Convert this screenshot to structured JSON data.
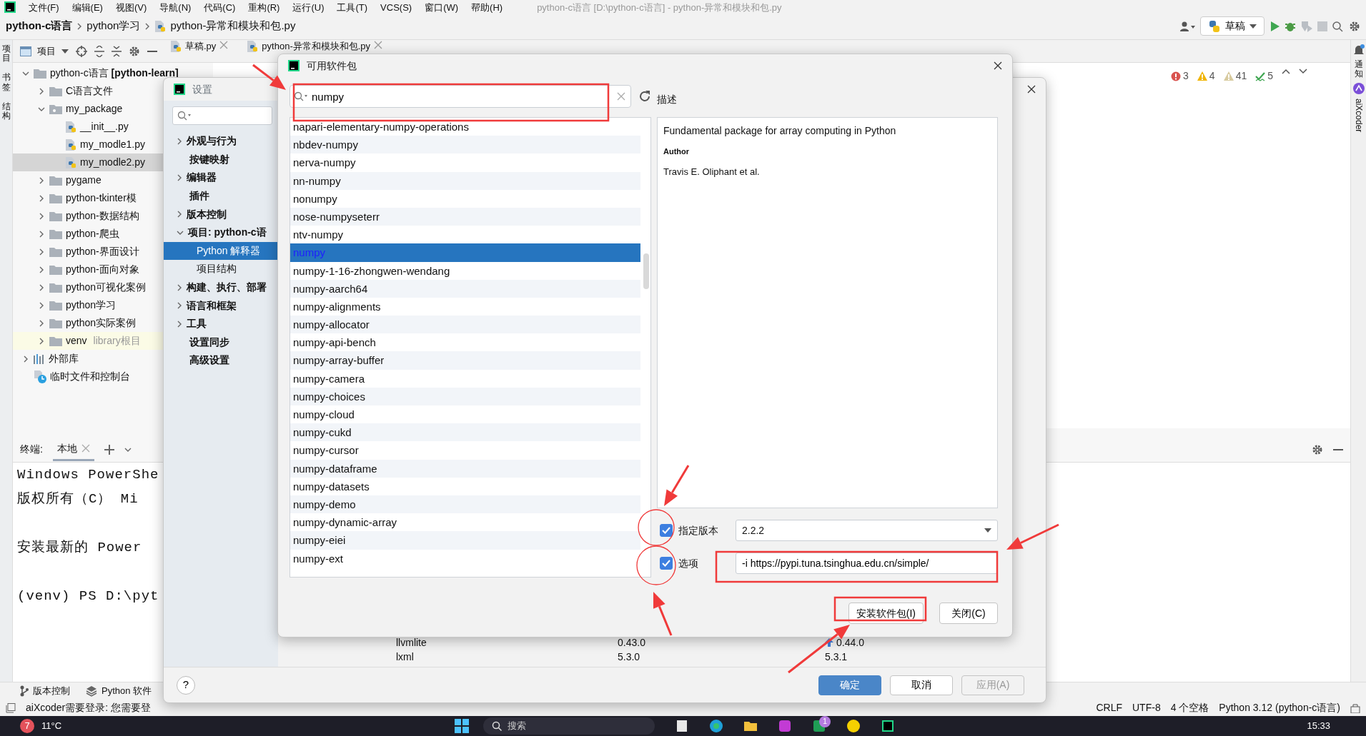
{
  "menu": [
    "文件(F)",
    "编辑(E)",
    "视图(V)",
    "导航(N)",
    "代码(C)",
    "重构(R)",
    "运行(U)",
    "工具(T)",
    "VCS(S)",
    "窗口(W)",
    "帮助(H)"
  ],
  "window": {
    "title": "python-c语言 [D:\\python-c语言] - python-异常和模块和包.py"
  },
  "breadcrumbs": [
    "python-c语言",
    "python学习",
    "python-异常和模块和包.py"
  ],
  "run_config": {
    "label": "草稿"
  },
  "left_stripe": [
    "项目",
    "书签",
    "结构"
  ],
  "project_view": {
    "label": "项目"
  },
  "editor_tabs": [
    {
      "label": "草稿.py"
    },
    {
      "label": "python-异常和模块和包.py"
    }
  ],
  "inspections": [
    {
      "kind": "error",
      "count": "3"
    },
    {
      "kind": "warning",
      "count": "4"
    },
    {
      "kind": "weak",
      "count": "41"
    },
    {
      "kind": "ok",
      "count": "5"
    }
  ],
  "project_tree": [
    {
      "label": "python-c语言 **[python-learn]**",
      "kind": "folder",
      "expanded": true,
      "selected": false,
      "children": [
        {
          "label": "C语言文件",
          "kind": "folder",
          "expanded": false,
          "selected": false
        },
        {
          "label": "my_package",
          "kind": "package",
          "expanded": true,
          "selected": false,
          "children": [
            {
              "label": "__init__.py",
              "kind": "file",
              "selected": false
            },
            {
              "label": "my_modle1.py",
              "kind": "file",
              "selected": false
            },
            {
              "label": "my_modle2.py",
              "kind": "file",
              "selected": true
            }
          ]
        },
        {
          "label": "pygame",
          "kind": "folder",
          "expanded": false,
          "selected": false
        },
        {
          "label": "python-tkinter模",
          "kind": "folder",
          "expanded": false,
          "selected": false
        },
        {
          "label": "python-数据结构",
          "kind": "folder",
          "expanded": false,
          "selected": false
        },
        {
          "label": "python-爬虫",
          "kind": "folder",
          "expanded": false,
          "selected": false
        },
        {
          "label": "python-界面设计",
          "kind": "folder",
          "expanded": false,
          "selected": false
        },
        {
          "label": "python-面向对象",
          "kind": "folder",
          "expanded": false,
          "selected": false
        },
        {
          "label": "python可视化案例",
          "kind": "folder",
          "expanded": false,
          "selected": false
        },
        {
          "label": "python学习",
          "kind": "folder",
          "expanded": false,
          "selected": false
        },
        {
          "label": "python实际案例",
          "kind": "folder",
          "expanded": false,
          "selected": false
        },
        {
          "label": "venv",
          "hint": "library根目",
          "kind": "venv",
          "expanded": false,
          "selected": false
        }
      ]
    },
    {
      "label": "外部库",
      "kind": "library",
      "expanded": false,
      "selected": false
    },
    {
      "label": "临时文件和控制台",
      "kind": "scratch",
      "selected": false
    }
  ],
  "terminal": {
    "title": "终端:",
    "tab": "本地",
    "blocks": [
      [
        "Windows PowerShe",
        "版权所有（C） Mi"
      ],
      [
        "安装最新的 Power"
      ],
      [
        "(venv) PS D:\\pyt"
      ]
    ]
  },
  "tool_windows": [
    {
      "kind": "vcs",
      "label": "版本控制"
    },
    {
      "kind": "packages",
      "label": "Python 软件"
    }
  ],
  "status_bar": {
    "message": "aiXcoder需要登录: 您需要登",
    "items": [
      "CRLF",
      "UTF-8",
      "4 个空格",
      "Python 3.12 (python-c语言)"
    ]
  },
  "right_stripe": [
    "通知",
    "aiXcoder"
  ],
  "settings_dialog": {
    "title": "设置",
    "help": "?",
    "nav": [
      {
        "label": "外观与行为",
        "kind": "group",
        "expanded": false,
        "selected": false
      },
      {
        "label": "按键映射",
        "kind": "leaf",
        "selected": false
      },
      {
        "label": "编辑器",
        "kind": "group",
        "expanded": false,
        "selected": false
      },
      {
        "label": "插件",
        "kind": "leaf",
        "selected": false
      },
      {
        "label": "版本控制",
        "kind": "group",
        "expanded": false,
        "selected": false
      },
      {
        "label": "项目: python-c语",
        "kind": "group",
        "expanded": true,
        "selected": false
      },
      {
        "label": "Python 解释器",
        "kind": "child",
        "selected": true
      },
      {
        "label": "项目结构",
        "kind": "child",
        "selected": false
      },
      {
        "label": "构建、执行、部署",
        "kind": "group",
        "expanded": false,
        "selected": false
      },
      {
        "label": "语言和框架",
        "kind": "group",
        "expanded": false,
        "selected": false
      },
      {
        "label": "工具",
        "kind": "group",
        "expanded": false,
        "selected": false
      },
      {
        "label": "设置同步",
        "kind": "leaf",
        "selected": false
      },
      {
        "label": "高级设置",
        "kind": "leaf",
        "selected": false
      }
    ],
    "table_rows": [
      {
        "package": "llvmlite",
        "version": "0.43.0",
        "latest": "0.44.0",
        "upgrade": true
      },
      {
        "package": "lxml",
        "version": "5.3.0",
        "latest": "5.3.1",
        "upgrade": false
      }
    ],
    "buttons": [
      {
        "label": "确定",
        "kind": "primary",
        "disabled": false
      },
      {
        "label": "取消",
        "kind": "default",
        "disabled": false
      },
      {
        "label": "应用(A)",
        "kind": "default",
        "disabled": true
      }
    ]
  },
  "packages_dialog": {
    "title": "可用软件包",
    "search": {
      "value": "numpy"
    },
    "packages": [
      {
        "name": "napari-elementary-numpy-operations",
        "selected": false
      },
      {
        "name": "nbdev-numpy",
        "selected": false
      },
      {
        "name": "nerva-numpy",
        "selected": false
      },
      {
        "name": "nn-numpy",
        "selected": false
      },
      {
        "name": "nonumpy",
        "selected": false
      },
      {
        "name": "nose-numpyseterr",
        "selected": false
      },
      {
        "name": "ntv-numpy",
        "selected": false
      },
      {
        "name": "numpy",
        "selected": true
      },
      {
        "name": "numpy-1-16-zhongwen-wendang",
        "selected": false
      },
      {
        "name": "numpy-aarch64",
        "selected": false
      },
      {
        "name": "numpy-alignments",
        "selected": false
      },
      {
        "name": "numpy-allocator",
        "selected": false
      },
      {
        "name": "numpy-api-bench",
        "selected": false
      },
      {
        "name": "numpy-array-buffer",
        "selected": false
      },
      {
        "name": "numpy-camera",
        "selected": false
      },
      {
        "name": "numpy-choices",
        "selected": false
      },
      {
        "name": "numpy-cloud",
        "selected": false
      },
      {
        "name": "numpy-cukd",
        "selected": false
      },
      {
        "name": "numpy-cursor",
        "selected": false
      },
      {
        "name": "numpy-dataframe",
        "selected": false
      },
      {
        "name": "numpy-datasets",
        "selected": false
      },
      {
        "name": "numpy-demo",
        "selected": false
      },
      {
        "name": "numpy-dynamic-array",
        "selected": false
      },
      {
        "name": "numpy-eiei",
        "selected": false
      },
      {
        "name": "numpy-ext",
        "selected": false
      }
    ],
    "description_label": "描述",
    "description": {
      "summary": "Fundamental package for array computing in Python",
      "author_label": "Author",
      "author": "Travis E. Oliphant et al."
    },
    "version": {
      "label": "指定版本",
      "checked": true,
      "value": "2.2.2"
    },
    "options": {
      "label": "选项",
      "checked": true,
      "value": "-i https://pypi.tuna.tsinghua.edu.cn/simple/"
    },
    "buttons": [
      "安装软件包(I)",
      "关闭(C)"
    ]
  },
  "annotations": [
    {
      "kind": "arrow"
    },
    {
      "kind": "rectangle"
    },
    {
      "kind": "arrow"
    },
    {
      "kind": "circle"
    },
    {
      "kind": "circle"
    },
    {
      "kind": "arrow"
    },
    {
      "kind": "arrow"
    },
    {
      "kind": "rectangle"
    },
    {
      "kind": "rectangle"
    },
    {
      "kind": "arrow"
    }
  ],
  "taskbar": {
    "weather_badge": "7",
    "temperature": "11°C",
    "search_placeholder": "搜索",
    "app_badge": "1",
    "time": "15:33"
  }
}
